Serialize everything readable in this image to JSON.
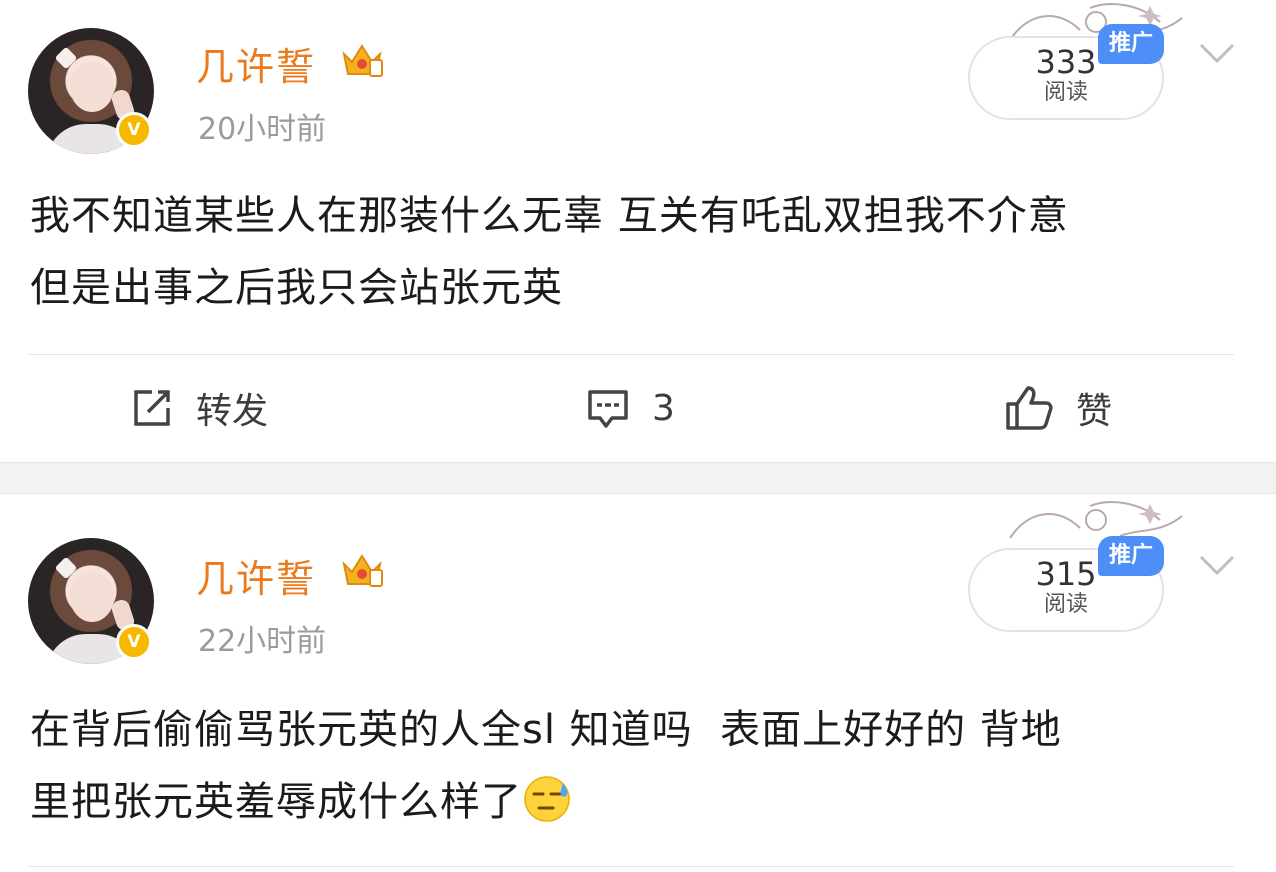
{
  "posts": [
    {
      "username": "几许誓",
      "timestamp": "20小时前",
      "read_count": "333",
      "read_label": "阅读",
      "promo_label": "推广",
      "content": "我不知道某些人在那装什么无辜 互关有吒乱双担我不介意\n但是出事之后我只会站张元英",
      "actions": {
        "repost": "转发",
        "comment": "3",
        "like": "赞"
      }
    },
    {
      "username": "几许誓",
      "timestamp": "22小时前",
      "read_count": "315",
      "read_label": "阅读",
      "promo_label": "推广",
      "content": "在背后偷偷骂张元英的人全sl 知道吗  表面上好好的 背地\n里把张元英羞辱成什么样了"
    }
  ],
  "colors": {
    "username": "#ea7a1b",
    "verified_badge": "#f7b800",
    "promo_tag": "#4d8ef7",
    "timestamp": "#9b9b9b"
  },
  "icons": [
    "crown-icon",
    "verified-icon",
    "chevron-down-icon",
    "repost-icon",
    "comment-icon",
    "like-icon",
    "sweat-smile-emoji"
  ]
}
